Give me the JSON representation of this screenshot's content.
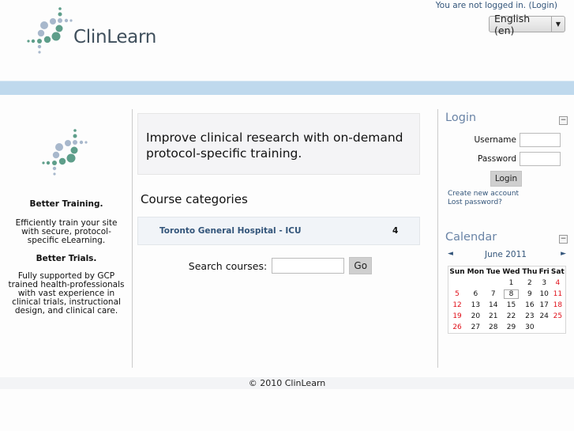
{
  "header": {
    "site_name": "ClinLearn",
    "login_status": "You are not logged in.",
    "login_link": "(Login)",
    "language": "English (en)",
    "colors": {
      "logo_green": "#5e9e8a",
      "logo_blue": "#a8b8cc",
      "bluebar": "#bfd9ed",
      "link": "#33557a"
    }
  },
  "left": {
    "heading1": "Better Training.",
    "text1": "Efficiently train your site with secure, protocol-specific eLearning.",
    "heading2": "Better Trials.",
    "text2": "Fully supported by GCP trained health-professionals with vast experience in clinical trials, instructional design, and clinical care."
  },
  "main": {
    "intro": "Improve clinical research with on-demand protocol-specific training.",
    "categories_heading": "Course categories",
    "categories": [
      {
        "name": "Toronto General Hospital - ICU",
        "count": "4"
      }
    ],
    "search_label": "Search courses:",
    "search_value": "",
    "go_label": "Go"
  },
  "login_block": {
    "title": "Login",
    "username_label": "Username",
    "password_label": "Password",
    "username_value": "",
    "password_value": "",
    "login_button": "Login",
    "create_account": "Create new account",
    "lost_password": "Lost password?"
  },
  "calendar": {
    "title": "Calendar",
    "month": "June 2011",
    "prev": "◄",
    "next": "►",
    "days": [
      "Sun",
      "Mon",
      "Tue",
      "Wed",
      "Thu",
      "Fri",
      "Sat"
    ],
    "today": 8,
    "weeks": [
      [
        "",
        "",
        "",
        "1",
        "2",
        "3",
        "4"
      ],
      [
        "5",
        "6",
        "7",
        "8",
        "9",
        "10",
        "11"
      ],
      [
        "12",
        "13",
        "14",
        "15",
        "16",
        "17",
        "18"
      ],
      [
        "19",
        "20",
        "21",
        "22",
        "23",
        "24",
        "25"
      ],
      [
        "26",
        "27",
        "28",
        "29",
        "30",
        "",
        ""
      ]
    ]
  },
  "footer": {
    "text": "© 2010 ClinLearn"
  }
}
